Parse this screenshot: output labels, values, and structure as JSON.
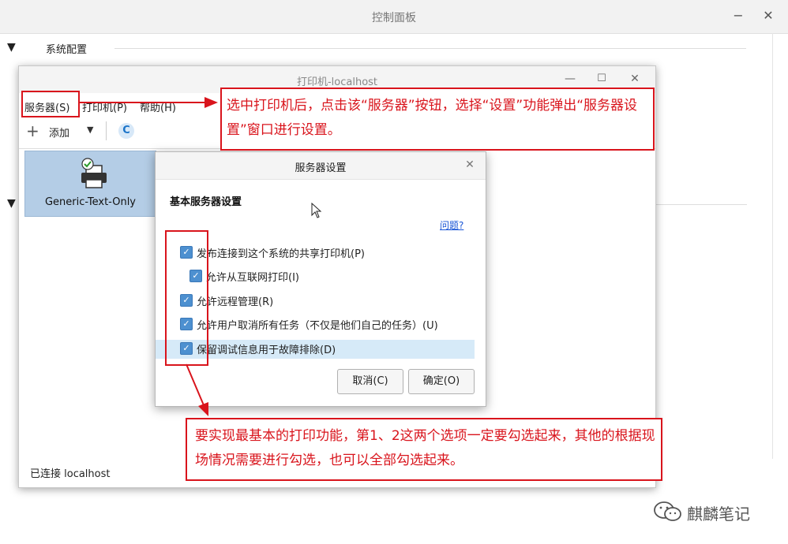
{
  "control_panel": {
    "title": "控制面板",
    "minimize": "−",
    "close": "✕",
    "section1_label": "系统配置",
    "section_toggle": "▼"
  },
  "printer_window": {
    "title": "打印机-localhost",
    "minimize": "—",
    "maximize": "☐",
    "close": "✕",
    "menu": {
      "server": "服务器(S)",
      "printer": "打印机(P)",
      "help": "帮助(H)"
    },
    "toolbar": {
      "add_icon": "+",
      "add_label": "添加",
      "add_caret": "▼",
      "refresh_icon": "C"
    },
    "printers": [
      {
        "name": "Generic-Text-Only"
      }
    ],
    "status": "已连接 localhost"
  },
  "server_settings": {
    "title": "服务器设置",
    "close": "✕",
    "heading": "基本服务器设置",
    "help_link": "问题?",
    "checkmark": "✓",
    "options": [
      {
        "label": "发布连接到这个系统的共享打印机(P)",
        "checked": true
      },
      {
        "label": "允许从互联网打印(I)",
        "checked": true
      },
      {
        "label": "允许远程管理(R)",
        "checked": true
      },
      {
        "label": "允许用户取消所有任务（不仅是他们自己的任务）(U)",
        "checked": true
      },
      {
        "label": "保留调试信息用于故障排除(D)",
        "checked": true
      }
    ],
    "cancel_button": "取消(C)",
    "ok_button": "确定(O)"
  },
  "annotations": {
    "note1": "选中打印机后，点击该“服务器”按钮，选择“设置”功能弹出“服务器设置”窗口进行设置。",
    "note2": "要实现最基本的打印功能，第1、2这两个选项一定要勾选起来，其他的根据现场情况需要进行勾选，也可以全部勾选起来。",
    "color": "#d9141c"
  },
  "watermark": {
    "text": "麒麟笔记"
  }
}
